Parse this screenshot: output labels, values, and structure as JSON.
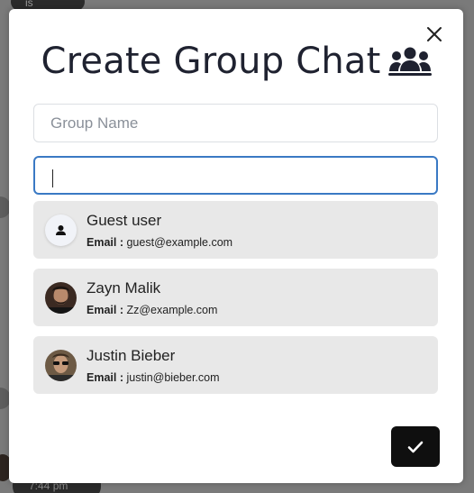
{
  "background": {
    "top_chip_text": "is",
    "bottom_chip_text": "7:44 pm"
  },
  "modal": {
    "title": "Create Group Chat",
    "title_icon": "users-icon",
    "close_icon": "close-icon",
    "group_name_placeholder": "Group Name",
    "group_name_value": "",
    "search_value": "",
    "submit_icon": "check-icon",
    "accent_color": "#3a79c4"
  },
  "users": [
    {
      "name": "Guest user",
      "email_label": "Email :",
      "email": "guest@example.com",
      "avatar": "default-user-avatar"
    },
    {
      "name": "Zayn Malik",
      "email_label": "Email :",
      "email": "Zz@example.com",
      "avatar": "photo-avatar"
    },
    {
      "name": "Justin Bieber",
      "email_label": "Email :",
      "email": "justin@bieber.com",
      "avatar": "photo-avatar"
    }
  ]
}
